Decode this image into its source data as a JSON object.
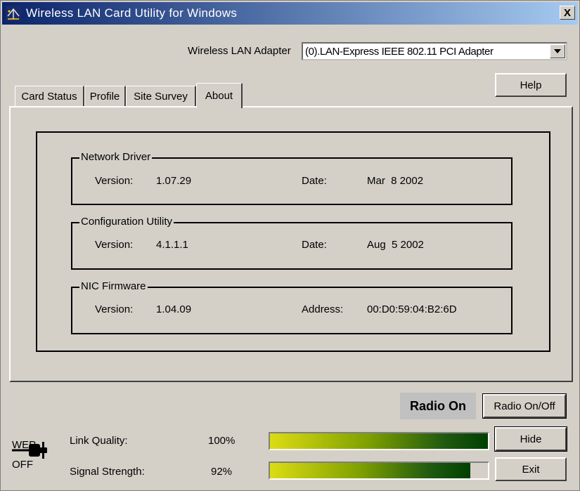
{
  "window": {
    "title": "Wireless LAN Card Utility for Windows",
    "close_glyph": "X"
  },
  "adapter": {
    "label": "Wireless LAN Adapter",
    "selected": "(0).LAN-Express IEEE 802.11 PCI Adapter"
  },
  "buttons": {
    "help": "Help",
    "radio_toggle": "Radio On/Off",
    "hide": "Hide",
    "exit": "Exit"
  },
  "tabs": [
    {
      "label": "Card Status"
    },
    {
      "label": "Profile"
    },
    {
      "label": "Site Survey"
    },
    {
      "label": "About"
    }
  ],
  "about": {
    "network_driver": {
      "title": "Network Driver",
      "version_label": "Version:",
      "version": "1.07.29",
      "second_label": "Date:",
      "second_value": "Mar  8 2002"
    },
    "config_utility": {
      "title": "Configuration Utility",
      "version_label": "Version:",
      "version": "4.1.1.1",
      "second_label": "Date:",
      "second_value": "Aug  5 2002"
    },
    "nic_firmware": {
      "title": "NIC Firmware",
      "version_label": "Version:",
      "version": "1.04.09",
      "second_label": "Address:",
      "second_value": "00:D0:59:04:B2:6D"
    }
  },
  "radio_status": "Radio On",
  "wep": {
    "line1": "WEP",
    "line2": "OFF"
  },
  "link_quality": {
    "label": "Link Quality:",
    "value_text": "100%",
    "level": 1.0
  },
  "signal_strength": {
    "label": "Signal Strength:",
    "value_text": "92%",
    "level": 0.92
  },
  "colors": {
    "titlebar_start": "#0a246a",
    "titlebar_end": "#a6caf0",
    "face": "#d4d0c8",
    "bar_yellow": "#dcdc14",
    "bar_green": "#004000"
  },
  "icons": [
    "network-app-icon",
    "close-icon",
    "dropdown-arrow-icon",
    "wep-key-icon"
  ]
}
